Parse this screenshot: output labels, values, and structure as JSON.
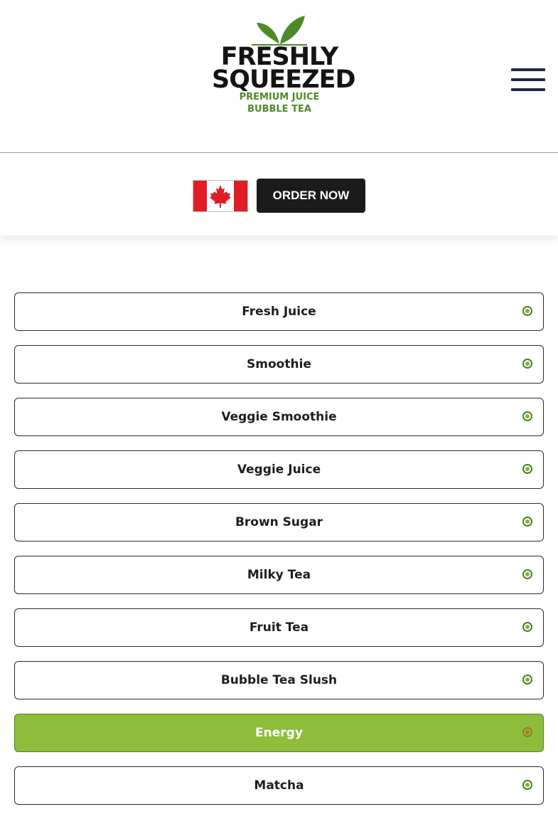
{
  "brand": {
    "line1": "FRESHLY",
    "line2": "SQUEEZED",
    "tag1": "PREMIUM JUICE",
    "tag2": "BUBBLE TEA",
    "green": "#4f8a2a"
  },
  "header": {
    "menu_icon": "hamburger-menu-icon"
  },
  "order": {
    "country_flag": "canada-flag-icon",
    "button_label": "ORDER NOW"
  },
  "categories": [
    {
      "label": "Fresh Juice",
      "active": false
    },
    {
      "label": "Smoothie",
      "active": false
    },
    {
      "label": "Veggie Smoothie",
      "active": false
    },
    {
      "label": "Veggie Juice",
      "active": false
    },
    {
      "label": "Brown Sugar",
      "active": false
    },
    {
      "label": "Milky Tea",
      "active": false
    },
    {
      "label": "Fruit Tea",
      "active": false
    },
    {
      "label": "Bubble Tea Slush",
      "active": false
    },
    {
      "label": "Energy",
      "active": true
    },
    {
      "label": "Matcha",
      "active": false
    }
  ],
  "colors": {
    "active_bg": "#8dbd3a",
    "button_bg": "#1b1b1b",
    "menu_icon": "#1f2a44"
  }
}
